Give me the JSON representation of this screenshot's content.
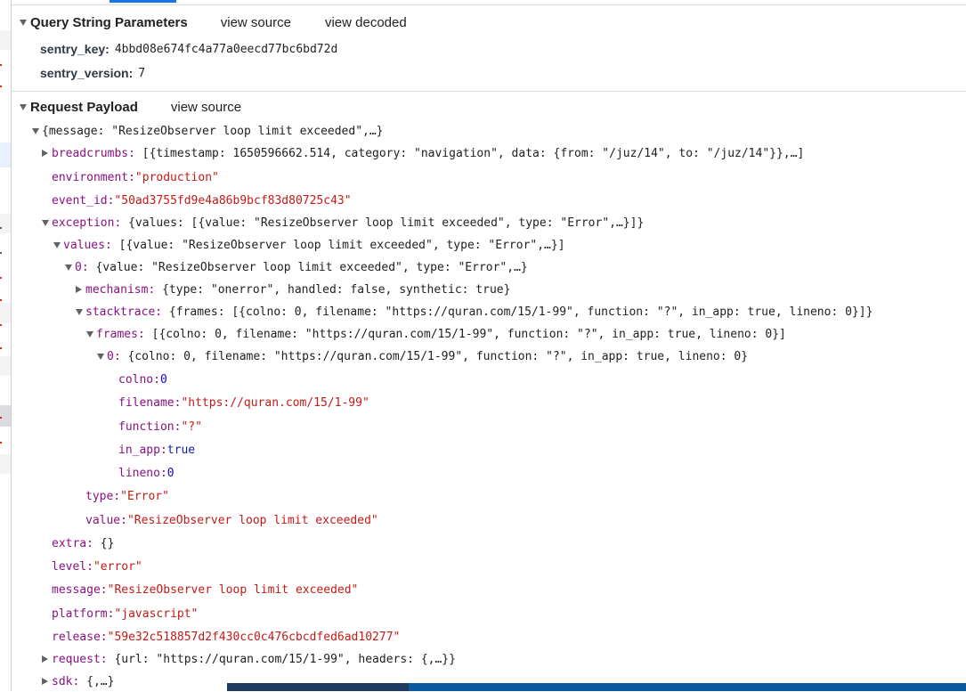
{
  "query_section": {
    "title": "Query String Parameters",
    "view_source": "view source",
    "view_decoded": "view decoded",
    "params": [
      {
        "key": "sentry_key:",
        "value": "4bbd08e674fc4a77a0eecd77bc6bd72d"
      },
      {
        "key": "sentry_version:",
        "value": "7"
      }
    ]
  },
  "payload_section": {
    "title": "Request Payload",
    "view_source": "view source"
  },
  "tree": {
    "root": "{message: \"ResizeObserver loop limit exceeded\",…}",
    "breadcrumbs_key": "breadcrumbs:",
    "breadcrumbs_val": " [{timestamp: 1650596662.514, category: \"navigation\", data: {from: \"/juz/14\", to: \"/juz/14\"}},…]",
    "environment_key": "environment:",
    "environment_val": "\"production\"",
    "event_id_key": "event_id:",
    "event_id_val": "\"50ad3755fd9e4a86b9bcf83d80725c43\"",
    "exception_key": "exception:",
    "exception_val": " {values: [{value: \"ResizeObserver loop limit exceeded\", type: \"Error\",…}]}",
    "values_key": "values:",
    "values_val": " [{value: \"ResizeObserver loop limit exceeded\", type: \"Error\",…}]",
    "zero_key": "0:",
    "zero_val": " {value: \"ResizeObserver loop limit exceeded\", type: \"Error\",…}",
    "mechanism_key": "mechanism:",
    "mechanism_val": " {type: \"onerror\", handled: false, synthetic: true}",
    "stacktrace_key": "stacktrace:",
    "stacktrace_val": " {frames: [{colno: 0, filename: \"https://quran.com/15/1-99\", function: \"?\", in_app: true, lineno: 0}]}",
    "frames_key": "frames:",
    "frames_val": " [{colno: 0, filename: \"https://quran.com/15/1-99\", function: \"?\", in_app: true, lineno: 0}]",
    "frame0_key": "0:",
    "frame0_val": " {colno: 0, filename: \"https://quran.com/15/1-99\", function: \"?\", in_app: true, lineno: 0}",
    "colno_key": "colno:",
    "colno_val": "0",
    "filename_key": "filename:",
    "filename_val": "\"https://quran.com/15/1-99\"",
    "function_key": "function:",
    "function_val": "\"?\"",
    "in_app_key": "in_app:",
    "in_app_val": "true",
    "lineno_key": "lineno:",
    "lineno_val": "0",
    "type_key": "type:",
    "type_val": "\"Error\"",
    "value_key": "value:",
    "value_val": "\"ResizeObserver loop limit exceeded\"",
    "extra_key": "extra:",
    "extra_val": " {}",
    "level_key": "level:",
    "level_val": "\"error\"",
    "message_key": "message:",
    "message_val": "\"ResizeObserver loop limit exceeded\"",
    "platform_key": "platform:",
    "platform_val": "\"javascript\"",
    "release_key": "release:",
    "release_val": "\"59e32c518857d2f430cc0c476cbcdfed6ad10277\"",
    "request_key": "request:",
    "request_val": " {url: \"https://quran.com/15/1-99\", headers: {,…}}",
    "sdk_key": "sdk:",
    "sdk_val": " {,…}"
  },
  "colors": {
    "key": "#881280",
    "string": "#c41a16",
    "number": "#1c00cf",
    "keyword": "#0d22aa",
    "tab_accent": "#1a73e8"
  }
}
